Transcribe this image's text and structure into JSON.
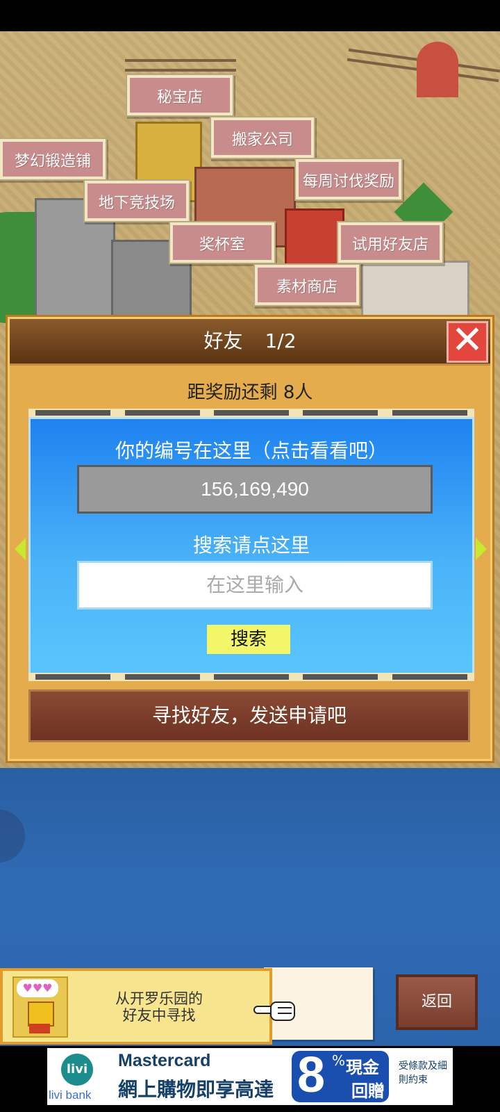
{
  "map": {
    "labels": [
      {
        "id": "secret-shop",
        "text": "秘宝店"
      },
      {
        "id": "moving-company",
        "text": "搬家公司"
      },
      {
        "id": "dream-forge",
        "text": "梦幻锻造铺"
      },
      {
        "id": "weekly-reward",
        "text": "每周讨伐奖励"
      },
      {
        "id": "underground-arena",
        "text": "地下竞技场"
      },
      {
        "id": "trophy-room",
        "text": "奖杯室"
      },
      {
        "id": "trial-friend-shop",
        "text": "试用好友店"
      },
      {
        "id": "material-shop",
        "text": "素材商店"
      }
    ]
  },
  "dialog": {
    "title": "好友",
    "page": "1/2",
    "reward_remaining": "距奖励还剩 8人",
    "id_hint": "你的编号在这里（点击看看吧）",
    "player_id": "156,169,490",
    "search_hint": "搜索请点这里",
    "search_placeholder": "在这里输入",
    "search_button": "搜索",
    "find_friends": "寻找好友，发送申请吧",
    "close_symbol": "✕"
  },
  "bottom": {
    "kairo_text_line1": "从开罗乐园的",
    "kairo_text_line2": "好友中寻找",
    "bubble_hearts": "♥♥♥",
    "back_button": "返回"
  },
  "ad": {
    "logo": "livi",
    "brand": "livi bank",
    "title": "Mastercard",
    "subtitle": "網上購物即享高達",
    "number": "8",
    "percent": "%",
    "cash": "現金",
    "rebate": "回贈",
    "terms": "受條款及細則約束"
  },
  "colors": {
    "label_bg": "#c88c8c",
    "dialog_frame": "#e4ac4c",
    "panel_blue": "#1e82f0",
    "search_button": "#f4f66a",
    "close_red": "#e2463c"
  }
}
